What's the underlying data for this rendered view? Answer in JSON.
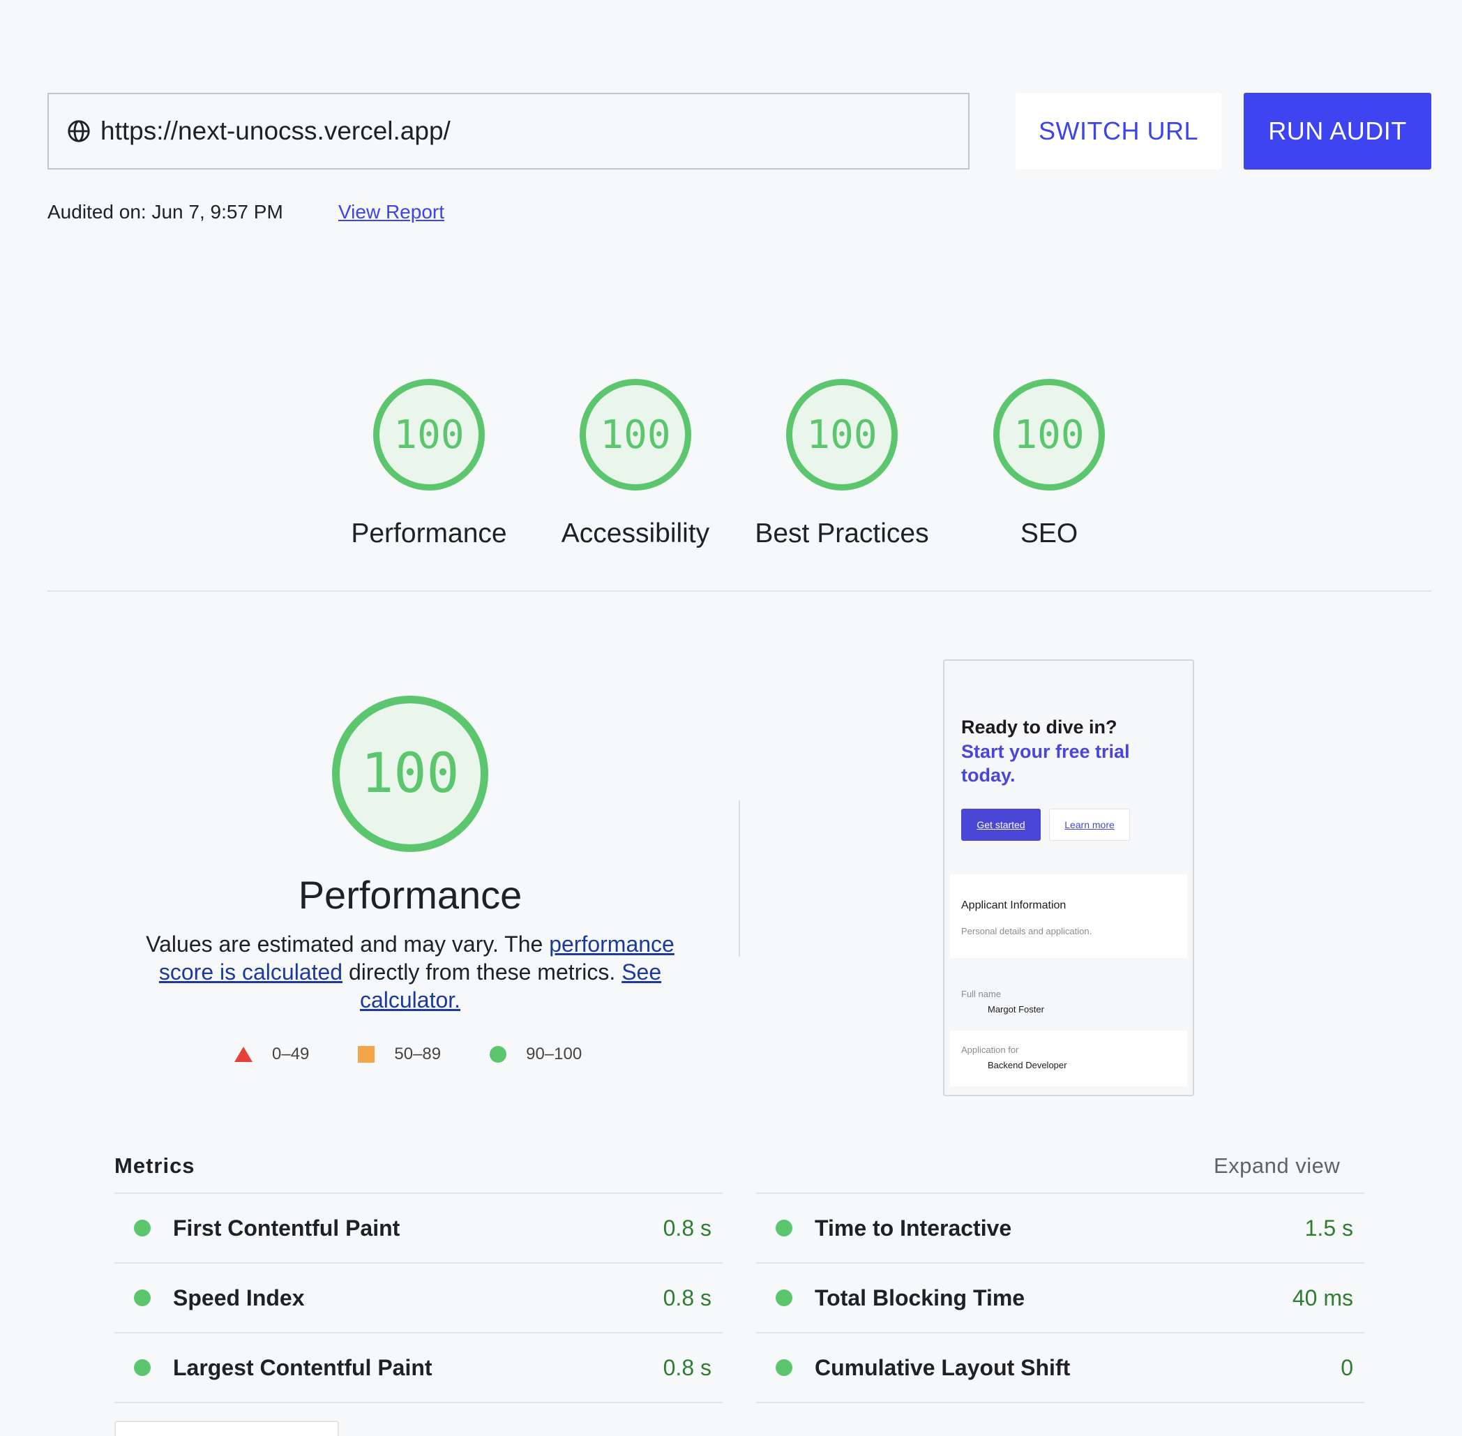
{
  "toolbar": {
    "url": "https://next-unocss.vercel.app/",
    "switch_label": "SWITCH URL",
    "run_label": "RUN AUDIT",
    "audited_text": "Audited on: Jun 7, 9:57 PM",
    "view_report": "View Report"
  },
  "scores": [
    {
      "label": "Performance",
      "value": "100"
    },
    {
      "label": "Accessibility",
      "value": "100"
    },
    {
      "label": "Best Practices",
      "value": "100"
    },
    {
      "label": "SEO",
      "value": "100"
    }
  ],
  "performance": {
    "score": "100",
    "title": "Performance",
    "desc_1": "Values are estimated and may vary. The ",
    "link_1": "performance score is calculated",
    "desc_2": " directly from these metrics. ",
    "link_2": "See calculator.",
    "legend": [
      {
        "range": "0–49",
        "color": "#e5423a"
      },
      {
        "range": "50–89",
        "color": "#f3a54a"
      },
      {
        "range": "90–100",
        "color": "#5cc66e"
      }
    ]
  },
  "thumbnail": {
    "heading": "Ready to dive in?",
    "subheading": "Start your free trial today.",
    "primary_button": "Get started",
    "secondary_button": "Learn more",
    "card_title": "Applicant Information",
    "card_subtitle": "Personal details and application.",
    "field1_label": "Full name",
    "field1_value": "Margot Foster",
    "field2_label": "Application for",
    "field2_value": "Backend Developer"
  },
  "metrics": {
    "title": "Metrics",
    "expand": "Expand view",
    "left": [
      {
        "name": "First Contentful Paint",
        "value": "0.8 s"
      },
      {
        "name": "Speed Index",
        "value": "0.8 s"
      },
      {
        "name": "Largest Contentful Paint",
        "value": "0.8 s"
      }
    ],
    "right": [
      {
        "name": "Time to Interactive",
        "value": "1.5 s"
      },
      {
        "name": "Total Blocking Time",
        "value": "40 ms"
      },
      {
        "name": "Cumulative Layout Shift",
        "value": "0"
      }
    ]
  },
  "colors": {
    "accent": "#3d44f0",
    "pass": "#5cc66e"
  }
}
